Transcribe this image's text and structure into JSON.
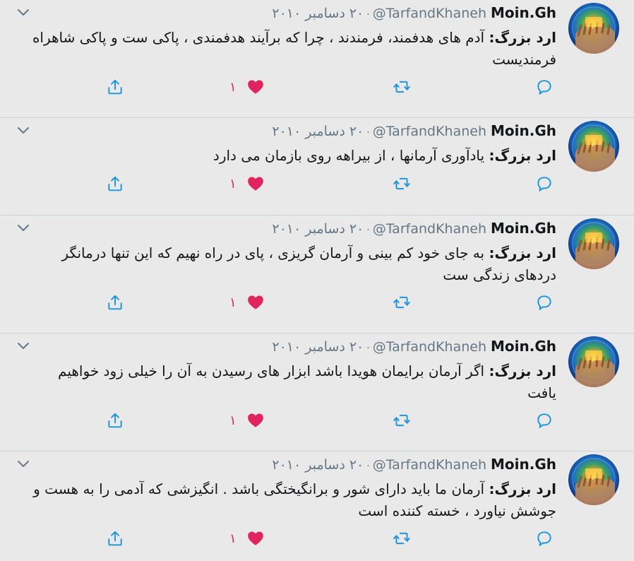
{
  "feed": {
    "tweets": [
      {
        "author_name": "Moin.Gh",
        "handle": "@TarfandKhaneh",
        "separator": "·",
        "date": "۲۰ دسامبر ۲۰۱۰",
        "quote_prefix": "ارد بزرگ:",
        "text": "آدم های هدفمند، فرمندند ، چرا که برآیند هدفمندی ، پاکی ست و پاکی شاهراه فرمندیست",
        "like_count": "۱"
      },
      {
        "author_name": "Moin.Gh",
        "handle": "@TarfandKhaneh",
        "separator": "·",
        "date": "۲۰ دسامبر ۲۰۱۰",
        "quote_prefix": "ارد بزرگ:",
        "text": "یادآوری آرمانها ، از بیراهه روی بازمان می دارد",
        "like_count": "۱"
      },
      {
        "author_name": "Moin.Gh",
        "handle": "@TarfandKhaneh",
        "separator": "·",
        "date": "۲۰ دسامبر ۲۰۱۰",
        "quote_prefix": "ارد بزرگ:",
        "text": "به جای خود کم بینی و آرمان گریزی ، پای در راه نهیم که این تنها درمانگر دردهای زندگی ست",
        "like_count": "۱"
      },
      {
        "author_name": "Moin.Gh",
        "handle": "@TarfandKhaneh",
        "separator": "·",
        "date": "۲۰ دسامبر ۲۰۱۰",
        "quote_prefix": "ارد بزرگ:",
        "text": "اگر آرمان برایمان هویدا باشد ابزار های رسیدن به آن را خیلی زود خواهیم یافت",
        "like_count": "۱"
      },
      {
        "author_name": "Moin.Gh",
        "handle": "@TarfandKhaneh",
        "separator": "·",
        "date": "۲۰ دسامبر ۲۰۱۰",
        "quote_prefix": "ارد بزرگ:",
        "text": "آرمان ما باید دارای شور و برانگیختگی باشد . انگیزشی که آدمی را به هست و جوشش نیاورد ، خسته کننده است",
        "like_count": "۱"
      }
    ]
  },
  "icons": {
    "reply": "reply-icon",
    "retweet": "retweet-icon",
    "like": "heart-icon",
    "share": "share-icon",
    "menu": "chevron-down-icon",
    "avatar": "avatar-image"
  },
  "colors": {
    "background": "#e9e9e9",
    "divider": "#c9d3da",
    "text": "#14171a",
    "muted": "#657786",
    "icon": "#1b95e0",
    "like": "#e0245e"
  }
}
